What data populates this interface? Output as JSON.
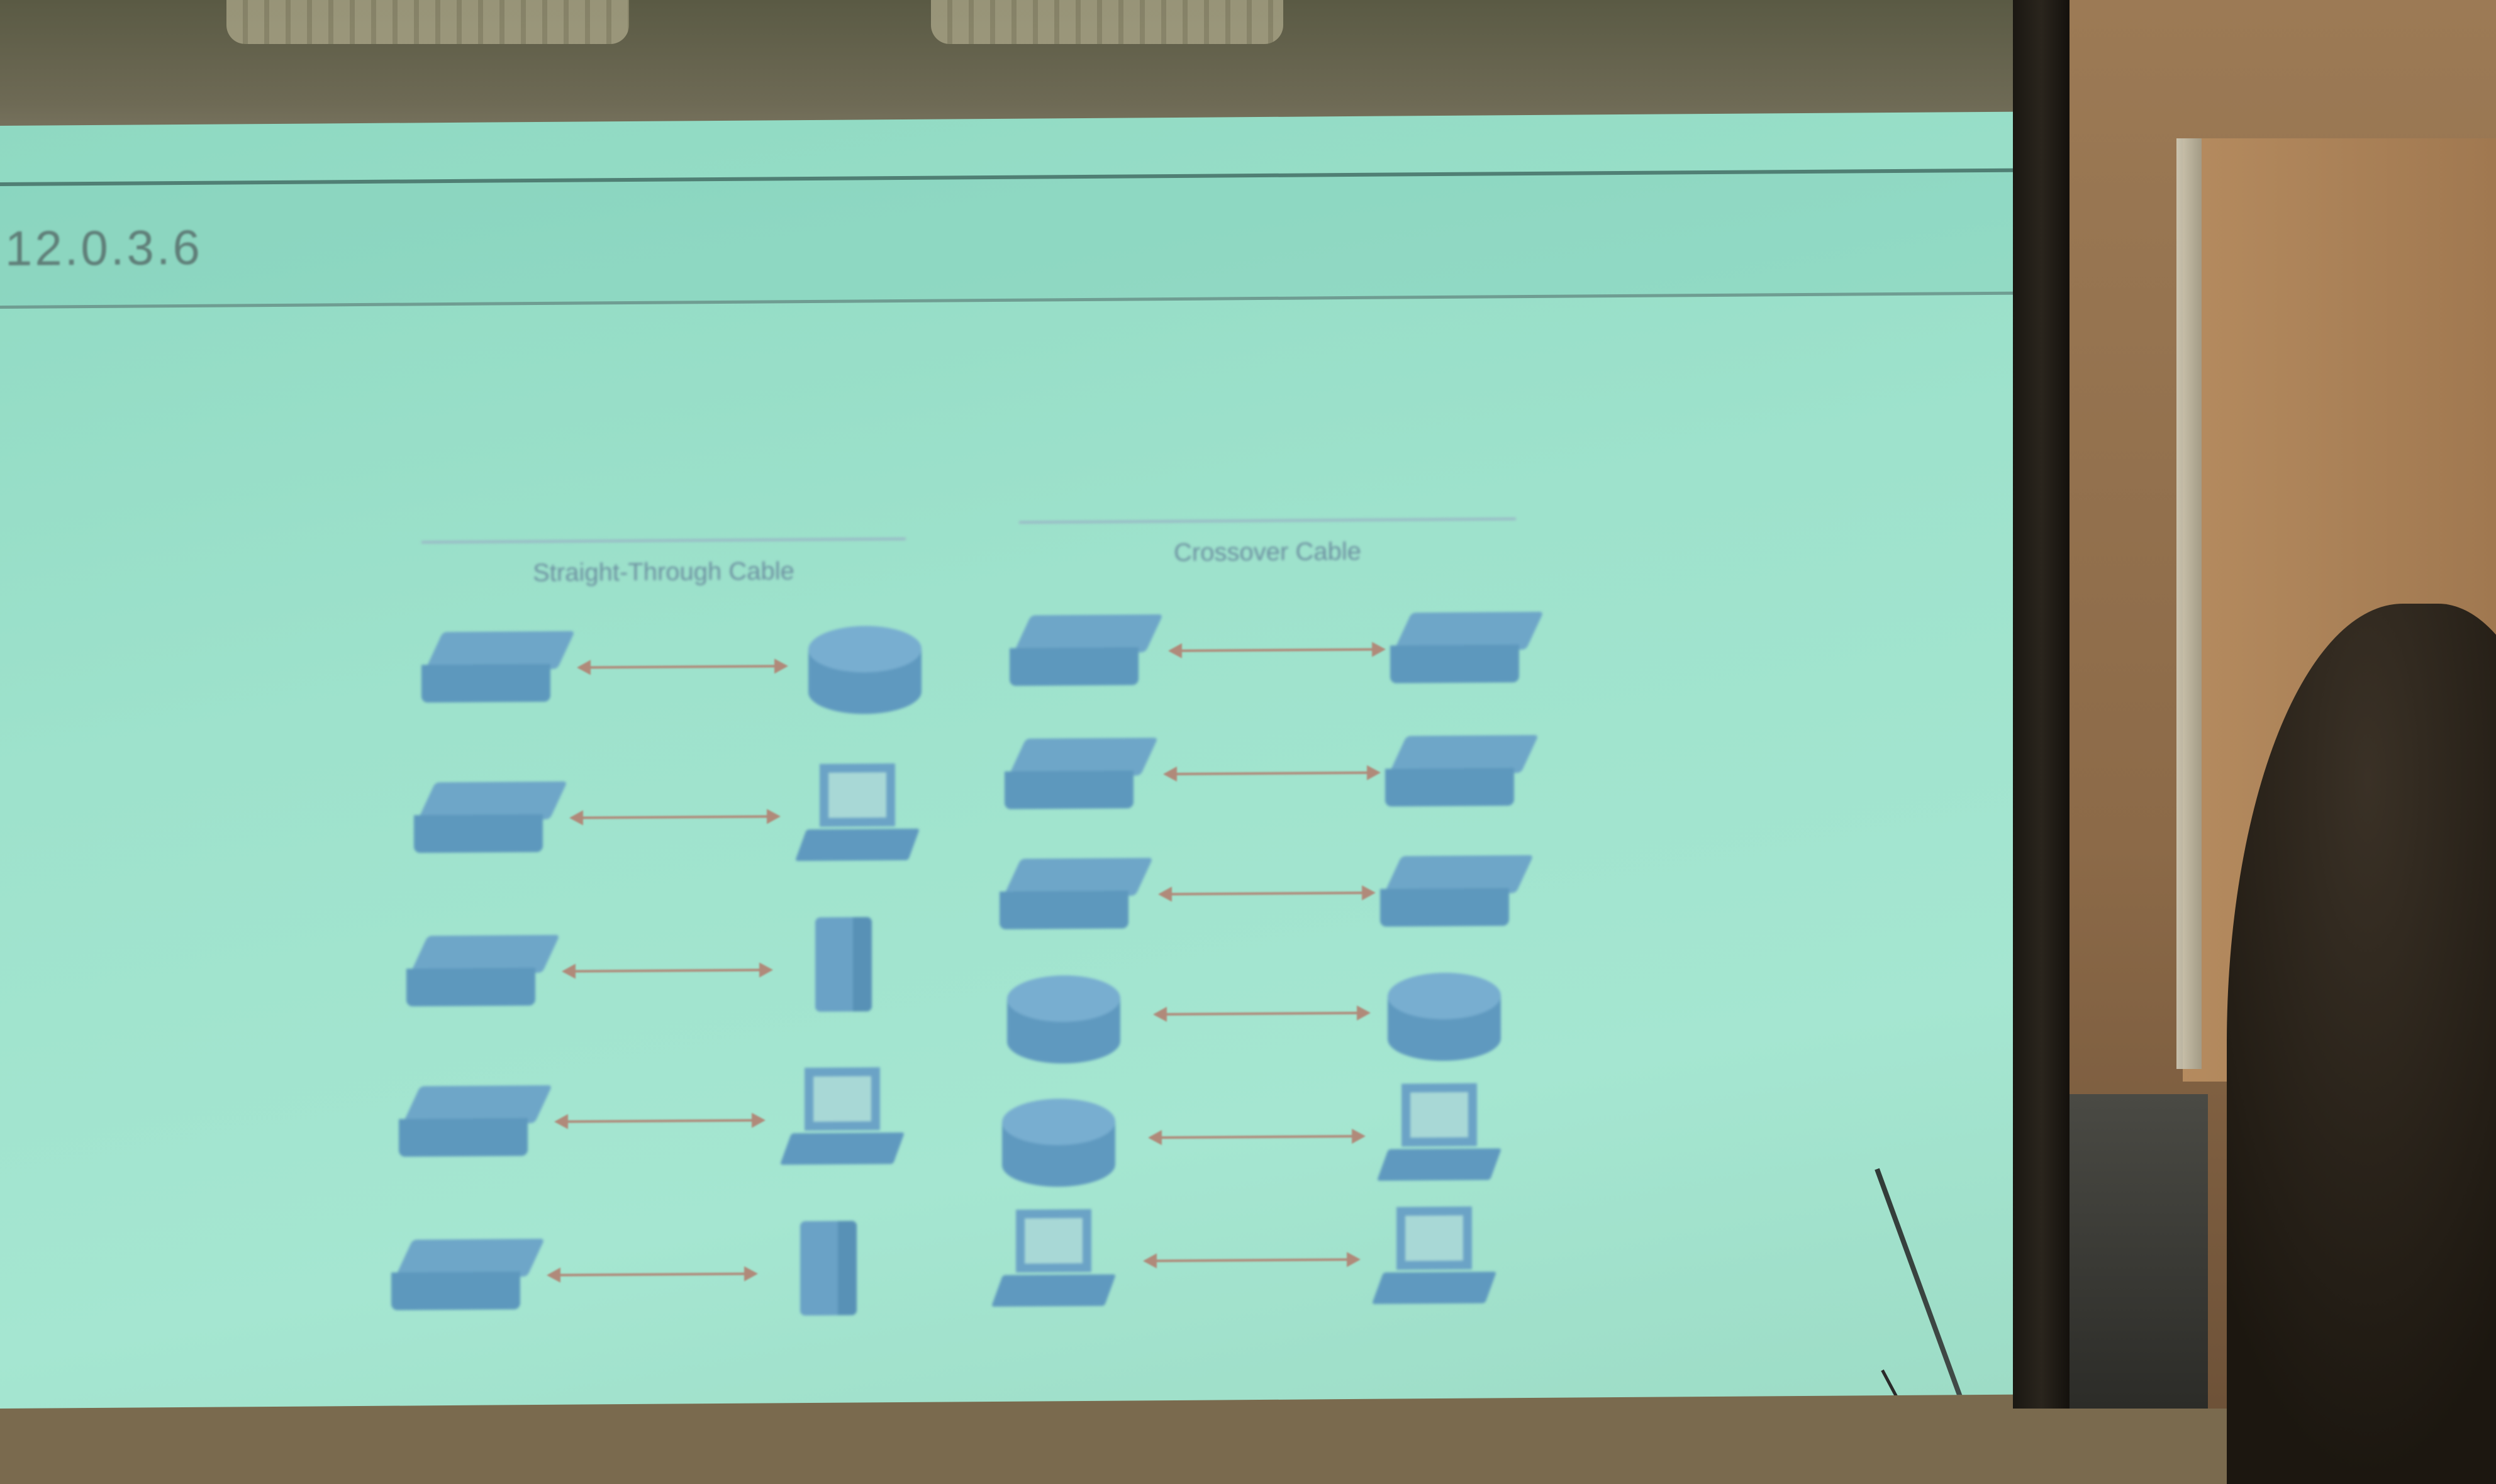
{
  "screen": {
    "version_label": "12.0.3.6",
    "left_panel_title": "Straight-Through Cable",
    "right_panel_title": "Crossover Cable"
  },
  "left_panel_pairs": [
    {
      "from": "switch",
      "to": "router"
    },
    {
      "from": "switch",
      "to": "pc"
    },
    {
      "from": "switch",
      "to": "server"
    },
    {
      "from": "switch",
      "to": "pc"
    },
    {
      "from": "switch",
      "to": "server"
    }
  ],
  "right_panel_pairs": [
    {
      "from": "switch",
      "to": "switch"
    },
    {
      "from": "switch",
      "to": "switch"
    },
    {
      "from": "switch",
      "to": "switch"
    },
    {
      "from": "router",
      "to": "router"
    },
    {
      "from": "router",
      "to": "pc"
    },
    {
      "from": "pc",
      "to": "pc"
    }
  ],
  "colors": {
    "screen": "#9ee2cc",
    "device": "#6aa2c6",
    "arrow": "#b08a7a"
  }
}
